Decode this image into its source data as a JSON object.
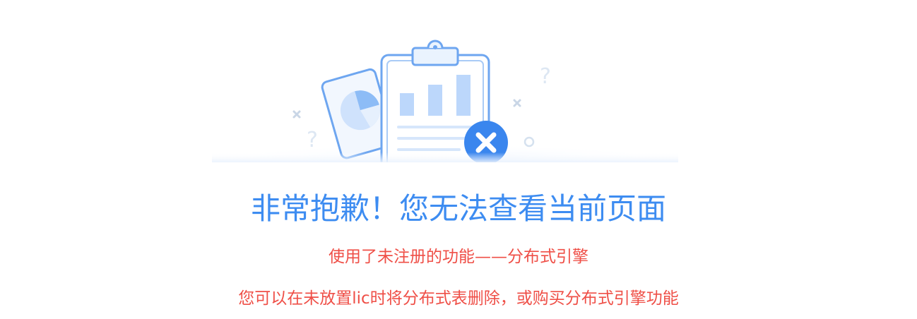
{
  "error": {
    "title": "非常抱歉！您无法查看当前页面",
    "message_primary": "使用了未注册的功能——分布式引擎",
    "message_secondary": "您可以在未放置lic时将分布式表删除，或购买分布式引擎功能"
  },
  "illustration": {
    "icon": "clipboard-chart-error-illustration",
    "accent": "#3d8cf1",
    "status_color": "#3d8cf1"
  },
  "colors": {
    "title": "#3d8cf1",
    "message": "#ef4f47"
  }
}
